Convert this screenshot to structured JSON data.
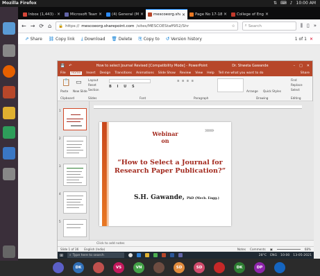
{
  "os": {
    "app_name": "Mozilla Firefox",
    "clock": "10:00 AM",
    "tray_icons": [
      "network-icon",
      "keyboard-icon",
      "volume-icon"
    ]
  },
  "tabs": [
    {
      "label": "Inbox (1,443) - jaya...",
      "color": "#d44638",
      "active": false
    },
    {
      "label": "Microsoft Teams Sig...",
      "color": "#6264a7",
      "active": false
    },
    {
      "label": "(4) General (MESCOE",
      "color": "#2d8cff",
      "active": false
    },
    {
      "label": "mescoeorg.sharep...",
      "color": "#b7472a",
      "active": true
    },
    {
      "label": "Page No 17-18 basi...",
      "color": "#e87722",
      "active": false
    },
    {
      "label": "College of Engineeri...",
      "color": "#c0392b",
      "active": false
    }
  ],
  "navbar": {
    "url_prefix": "https://",
    "url_host": "mescoeorg.sharepoint.com",
    "url_path": "/sites/MESCOEStaff952/Shr",
    "search_placeholder": "Search"
  },
  "actions": {
    "share": "Share",
    "copy_link": "Copy link",
    "download": "Download",
    "delete": "Delete",
    "copy_to": "Copy to",
    "version_history": "Version history",
    "page_count": "1 of 1"
  },
  "powerpoint": {
    "window_title": "How to select Journal Revised [Compatibility Mode] - PowerPoint",
    "user": "Dr. Shweta Gawande",
    "menu": [
      "File",
      "Home",
      "Insert",
      "Design",
      "Transitions",
      "Animations",
      "Slide Show",
      "Review",
      "View",
      "Help"
    ],
    "tell_me": "Tell me what you want to do",
    "share": "Share",
    "ribbon_groups": [
      "Clipboard",
      "Slides",
      "Font",
      "Paragraph",
      "Drawing",
      "Editing"
    ],
    "ribbon_buttons": {
      "paste": "Paste",
      "new_slide": "New Slide",
      "layout": "Layout",
      "reset": "Reset",
      "section": "Section",
      "find": "Find",
      "replace": "Replace",
      "select": "Select",
      "arrange": "Arrange",
      "quick_styles": "Quick Styles"
    },
    "slide": {
      "heading_line1": "Webinar",
      "heading_line2": "on",
      "title": "“How to Select a Journal for Research Paper Publication?”",
      "author": "S.H. Gawande,",
      "degrees": "PhD (Mech. Engg.)",
      "chevron": "»»»"
    },
    "notes_placeholder": "Click to add notes",
    "status": {
      "slide_of": "Slide 1 of 36",
      "language": "English (India)",
      "notes": "Notes",
      "comments": "Comments",
      "zoom": "68%"
    },
    "taskbar": {
      "search_placeholder": "Type here to search",
      "weather": "28°C",
      "lang": "ENG",
      "time": "10:00",
      "date": "13-05-2021"
    }
  },
  "participants": [
    {
      "initials": "",
      "color": "#5b5fc7"
    },
    {
      "initials": "DK",
      "color": "#2f6db5"
    },
    {
      "initials": "",
      "color": "#c0504d"
    },
    {
      "initials": "VS",
      "color": "#c2185b"
    },
    {
      "initials": "VN",
      "color": "#43a047"
    },
    {
      "initials": "",
      "color": "#6d4c41"
    },
    {
      "initials": "SD",
      "color": "#e08a3c"
    },
    {
      "initials": "SD",
      "color": "#d04a6b"
    },
    {
      "initials": "",
      "color": "#c62828"
    },
    {
      "initials": "DK",
      "color": "#2e7d32"
    },
    {
      "initials": "DP",
      "color": "#8e24aa"
    },
    {
      "initials": "",
      "color": "#1565c0"
    }
  ]
}
